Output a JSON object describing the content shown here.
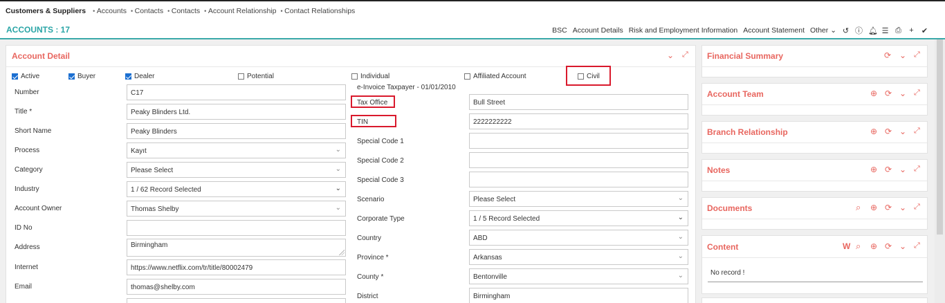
{
  "breadcrumb": {
    "root": "Customers & Suppliers",
    "items": [
      "Accounts",
      "Contacts",
      "Contacts",
      "Account Relationship",
      "Contact Relationships"
    ]
  },
  "header": {
    "title": "ACCOUNTS : 17",
    "links": [
      "BSC",
      "Account Details",
      "Risk and Employment Information",
      "Account Statement",
      "Other"
    ],
    "icons": [
      "history-icon",
      "info-icon",
      "bell-icon",
      "list-icon",
      "print-icon",
      "plus-icon",
      "check-icon"
    ]
  },
  "account_detail": {
    "title": "Account Detail",
    "checkboxes": [
      {
        "label": "Active",
        "checked": true
      },
      {
        "label": "Buyer",
        "checked": true
      },
      {
        "label": "Dealer",
        "checked": true
      },
      {
        "label": "Potential",
        "checked": false
      },
      {
        "label": "Individual",
        "checked": false
      },
      {
        "label": "Affiliated Account",
        "checked": false
      },
      {
        "label": "Civil",
        "checked": false
      }
    ],
    "einvoice_note": "e-Invoice Taxpayer - 01/01/2010",
    "left_fields": [
      {
        "label": "Number",
        "value": "C17"
      },
      {
        "label": "Title *",
        "value": "Peaky Blinders Ltd."
      },
      {
        "label": "Short Name",
        "value": "Peaky Blinders"
      },
      {
        "label": "Process",
        "value": "Kayıt"
      },
      {
        "label": "Category",
        "value": "Please Select"
      },
      {
        "label": "Industry",
        "value": "1 / 62 Record Selected"
      },
      {
        "label": "Account Owner",
        "value": "Thomas Shelby"
      },
      {
        "label": "ID No",
        "value": ""
      },
      {
        "label": "Address",
        "value": "Birmingham"
      },
      {
        "label": "Internet",
        "value": "https://www.netflix.com/tr/title/80002479"
      },
      {
        "label": "Email",
        "value": "thomas@shelby.com"
      }
    ],
    "right_fields": [
      {
        "label": "Tax Office",
        "value": "Bull Street"
      },
      {
        "label": "TIN",
        "value": "2222222222"
      },
      {
        "label": "Special Code 1",
        "value": ""
      },
      {
        "label": "Special Code 2",
        "value": ""
      },
      {
        "label": "Special Code 3",
        "value": ""
      },
      {
        "label": "Scenario",
        "value": "Please Select"
      },
      {
        "label": "Corporate Type",
        "value": "1 / 5 Record Selected"
      },
      {
        "label": "Country",
        "value": "ABD"
      },
      {
        "label": "Province *",
        "value": "Arkansas"
      },
      {
        "label": "County *",
        "value": "Bentonville"
      },
      {
        "label": "District",
        "value": "Birmingham"
      }
    ]
  },
  "side_panels": [
    {
      "title": "Financial Summary"
    },
    {
      "title": "Account Team"
    },
    {
      "title": "Branch Relationship"
    },
    {
      "title": "Notes"
    },
    {
      "title": "Documents"
    },
    {
      "title": "Content",
      "empty_text": "No record !",
      "w_label": "W"
    }
  ],
  "colors": {
    "accent": "#2aa5a6",
    "panel_title": "#e8665f",
    "highlight": "#d9192c",
    "checkbox": "#1b6fd1"
  }
}
